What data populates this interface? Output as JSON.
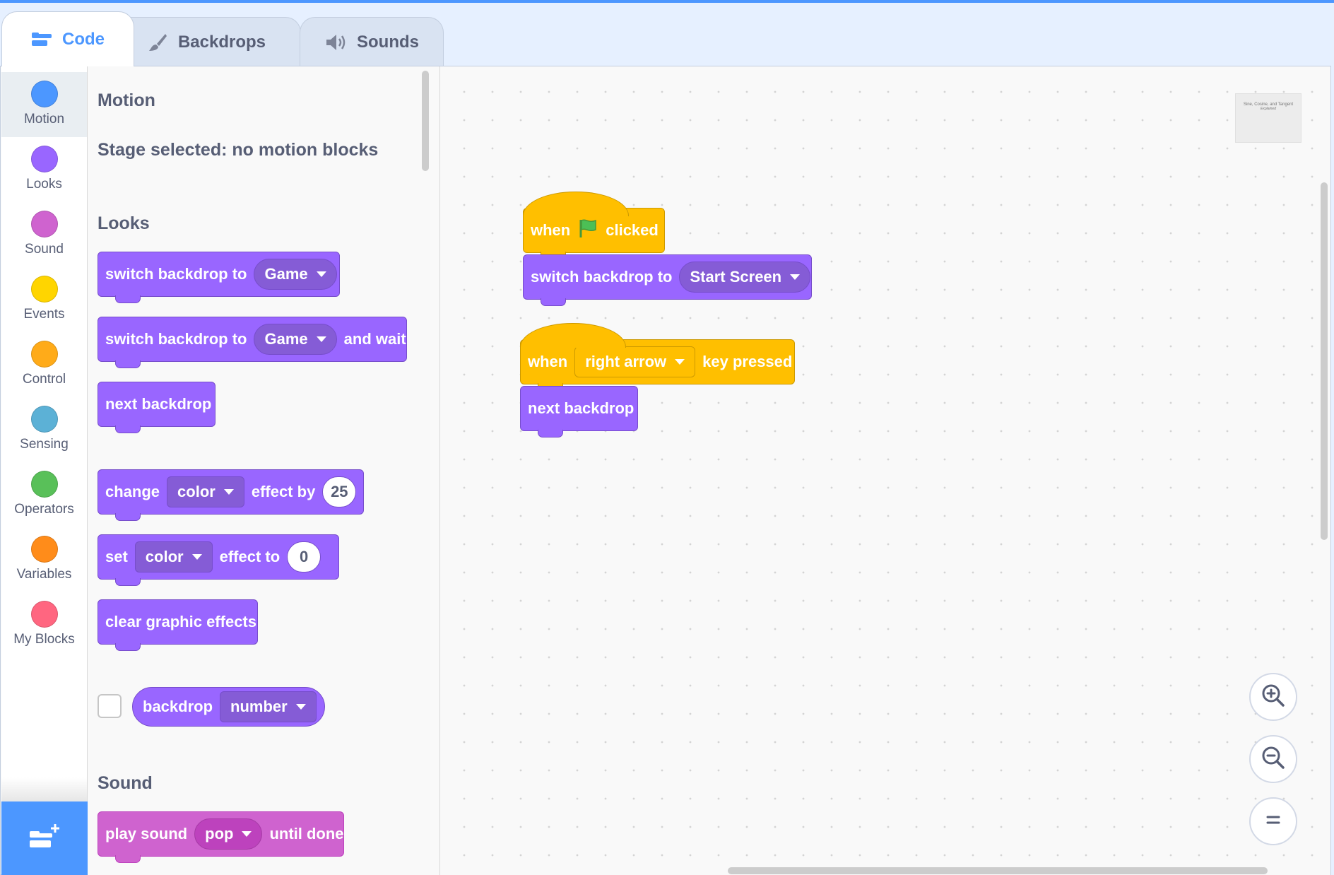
{
  "tabs": [
    {
      "label": "Code",
      "icon": "code-icon",
      "active": true
    },
    {
      "label": "Backdrops",
      "icon": "paintbrush-icon",
      "active": false
    },
    {
      "label": "Sounds",
      "icon": "speaker-icon",
      "active": false
    }
  ],
  "categories": [
    {
      "label": "Motion",
      "color": "#4c97ff"
    },
    {
      "label": "Looks",
      "color": "#9966ff"
    },
    {
      "label": "Sound",
      "color": "#cf63cf"
    },
    {
      "label": "Events",
      "color": "#ffd500"
    },
    {
      "label": "Control",
      "color": "#ffab19"
    },
    {
      "label": "Sensing",
      "color": "#5cb1d6"
    },
    {
      "label": "Operators",
      "color": "#59c059"
    },
    {
      "label": "Variables",
      "color": "#ff8c1a"
    },
    {
      "label": "My Blocks",
      "color": "#ff6680"
    }
  ],
  "flyout": {
    "motion_title": "Motion",
    "motion_note": "Stage selected: no motion blocks",
    "looks_title": "Looks",
    "sound_title": "Sound",
    "blocks": {
      "switch_backdrop": {
        "text": "switch backdrop to",
        "value": "Game"
      },
      "switch_backdrop_wait": {
        "text": "switch backdrop to",
        "value": "Game",
        "suffix": "and wait"
      },
      "next_backdrop": {
        "text": "next backdrop"
      },
      "change_effect": {
        "text1": "change",
        "value": "color",
        "text2": "effect by",
        "number": "25"
      },
      "set_effect": {
        "text1": "set",
        "value": "color",
        "text2": "effect to",
        "number": "0"
      },
      "clear_effects": {
        "text": "clear graphic effects"
      },
      "backdrop_reporter": {
        "text": "backdrop",
        "value": "number"
      },
      "play_sound": {
        "text1": "play sound",
        "value": "pop",
        "text2": "until done"
      }
    }
  },
  "workspace": {
    "stage_thumb": {
      "title": "Sine, Cosine, and Tangent",
      "subtitle": "Explained"
    },
    "script1": {
      "hat": {
        "text1": "when",
        "icon": "green-flag-icon",
        "text2": "clicked"
      },
      "block": {
        "text": "switch backdrop to",
        "value": "Start Screen"
      }
    },
    "script2": {
      "hat": {
        "text1": "when",
        "value": "right arrow",
        "text2": "key pressed"
      },
      "block": {
        "text": "next backdrop"
      }
    }
  }
}
